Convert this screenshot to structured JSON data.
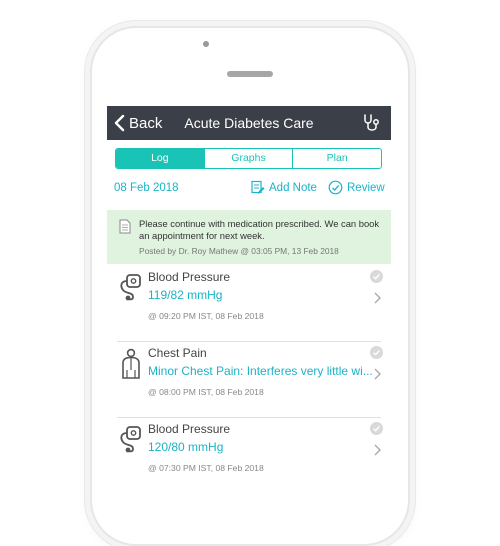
{
  "nav": {
    "back_label": "Back",
    "title": "Acute Diabetes Care",
    "right_icon": "stethoscope-icon"
  },
  "tabs": [
    {
      "label": "Log",
      "active": true
    },
    {
      "label": "Graphs",
      "active": false
    },
    {
      "label": "Plan",
      "active": false
    }
  ],
  "toolbar": {
    "date": "08 Feb 2018",
    "add_note_label": "Add Note",
    "review_label": "Review"
  },
  "note": {
    "text": "Please continue with medication prescribed. We can book an appointment for next week.",
    "meta": "Posted by Dr. Roy Mathew @ 03:05 PM, 13 Feb 2018"
  },
  "entries": [
    {
      "title": "Blood Pressure",
      "value": "119/82 mmHg",
      "time": "@ 09:20 PM IST, 08 Feb 2018",
      "icon": "blood-pressure-icon"
    },
    {
      "title": "Chest Pain",
      "value": "Minor Chest Pain: Interferes very little wi...",
      "time": "@ 08:00 PM IST, 08 Feb 2018",
      "icon": "person-icon"
    },
    {
      "title": "Blood Pressure",
      "value": "120/80 mmHg",
      "time": "@ 07:30 PM IST, 08 Feb 2018",
      "icon": "blood-pressure-icon"
    }
  ],
  "colors": {
    "navbar": "#3b3f47",
    "accent": "#19c4b6",
    "link": "#1ab3c8",
    "note_bg": "#dff3df"
  }
}
